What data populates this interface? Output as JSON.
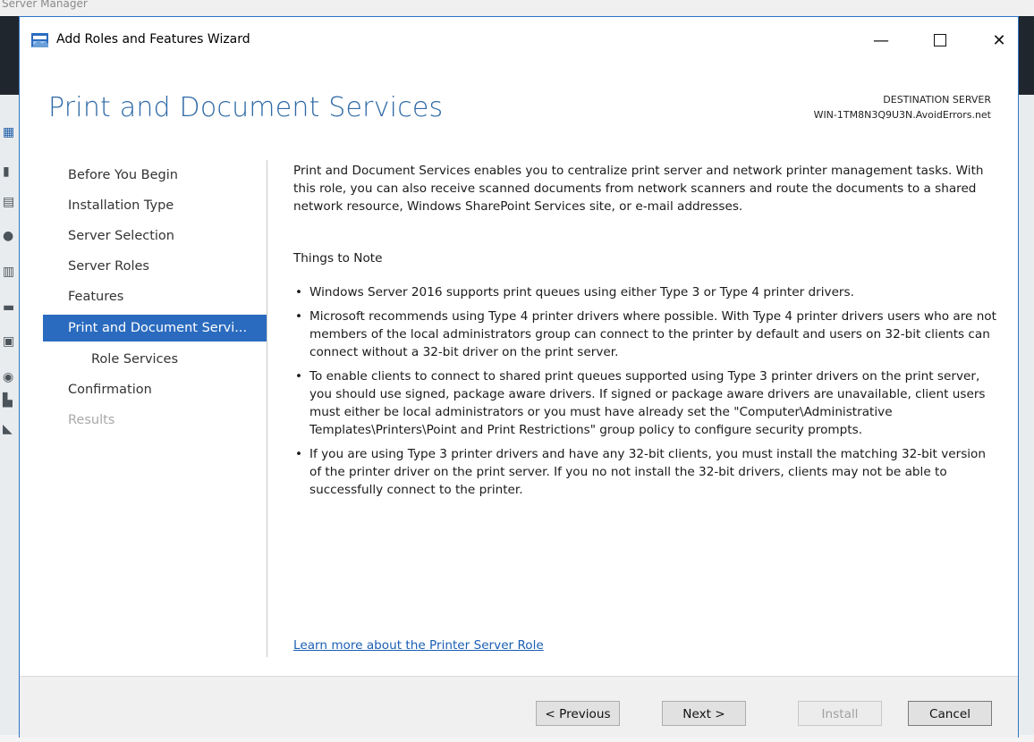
{
  "background": {
    "window_title": "Server Manager"
  },
  "wizard": {
    "title": "Add Roles and Features Wizard",
    "controls": {
      "minimize": "—",
      "close": "✕"
    },
    "page_title": "Print and Document Services",
    "destination": {
      "label": "DESTINATION SERVER",
      "server": "WIN-1TM8N3Q9U3N.AvoidErrors.net"
    }
  },
  "nav": {
    "items": [
      {
        "label": "Before You Begin"
      },
      {
        "label": "Installation Type"
      },
      {
        "label": "Server Selection"
      },
      {
        "label": "Server Roles"
      },
      {
        "label": "Features"
      },
      {
        "label": "Print and Document Servi..."
      },
      {
        "label": "Role Services"
      },
      {
        "label": "Confirmation"
      },
      {
        "label": "Results"
      }
    ],
    "active_index": 5
  },
  "content": {
    "intro": "Print and Document Services enables you to centralize print server and network printer management tasks. With this role, you can also receive scanned documents from network scanners and route the documents to a shared network resource, Windows SharePoint Services site, or e-mail addresses.",
    "notes_heading": "Things to Note",
    "bullet_symbol": "•",
    "bullets": [
      "Windows Server 2016 supports print queues using either Type 3 or Type 4 printer drivers.",
      "Microsoft recommends using Type 4 printer drivers where possible. With Type 4 printer drivers users who are not members of the local administrators group can connect to the printer by default and users on 32-bit clients can connect without a 32-bit driver on the print server.",
      "To enable clients to connect to shared print queues supported using Type 3 printer drivers on the print server, you should use signed, package aware drivers. If signed or package aware drivers are unavailable, client users must either be local administrators or you must have already set the \"Computer\\Administrative Templates\\Printers\\Point and Print Restrictions\" group policy to configure security prompts.",
      "If you are using Type 3 printer drivers and have any 32-bit clients, you must install the matching 32-bit version of the printer driver on the print server. If you no not install the 32-bit drivers, clients may not be able to successfully connect to the printer."
    ],
    "learn_more": "Learn more about the Printer Server Role"
  },
  "buttons": {
    "previous": "< Previous",
    "next": "Next >",
    "install": "Install",
    "cancel": "Cancel"
  },
  "colors": {
    "accent": "#2a6bbf",
    "title": "#2f6aa6",
    "link": "#1a5fb4",
    "footer": "#f0f0f0"
  }
}
